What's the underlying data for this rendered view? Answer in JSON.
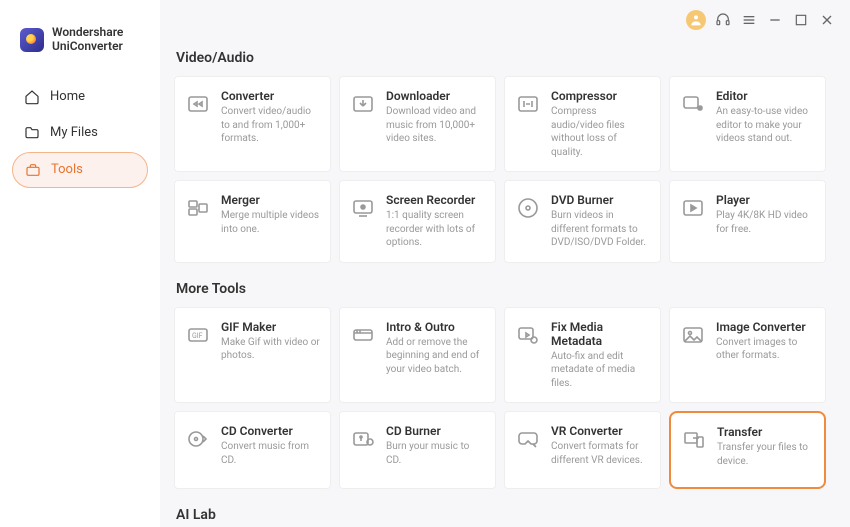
{
  "app": {
    "name": "Wondershare\nUniConverter"
  },
  "nav": {
    "home": "Home",
    "myfiles": "My Files",
    "tools": "Tools"
  },
  "sections": {
    "video_audio": "Video/Audio",
    "more_tools": "More Tools",
    "ai_lab": "AI Lab"
  },
  "cards": {
    "converter": {
      "title": "Converter",
      "desc": "Convert video/audio to and from 1,000+ formats."
    },
    "downloader": {
      "title": "Downloader",
      "desc": "Download video and music from 10,000+ video sites."
    },
    "compressor": {
      "title": "Compressor",
      "desc": "Compress audio/video files without loss of quality."
    },
    "editor": {
      "title": "Editor",
      "desc": "An easy-to-use video editor to make your videos stand out."
    },
    "merger": {
      "title": "Merger",
      "desc": "Merge multiple videos into one."
    },
    "screenrec": {
      "title": "Screen Recorder",
      "desc": "1:1 quality screen recorder with lots of options."
    },
    "dvdburner": {
      "title": "DVD Burner",
      "desc": "Burn videos in different formats to DVD/ISO/DVD Folder."
    },
    "player": {
      "title": "Player",
      "desc": "Play 4K/8K HD video for free."
    },
    "gifmaker": {
      "title": "GIF Maker",
      "desc": "Make Gif with video or photos."
    },
    "introoutro": {
      "title": "Intro & Outro",
      "desc": "Add or remove the beginning and end of your video batch."
    },
    "fixmeta": {
      "title": "Fix Media Metadata",
      "desc": "Auto-fix and edit metadate of media files."
    },
    "imgconv": {
      "title": "Image Converter",
      "desc": "Convert images to other formats."
    },
    "cdconv": {
      "title": "CD Converter",
      "desc": "Convert music from CD."
    },
    "cdburner": {
      "title": "CD Burner",
      "desc": "Burn your music to CD."
    },
    "vrconv": {
      "title": "VR Converter",
      "desc": "Convert formats for different VR devices."
    },
    "transfer": {
      "title": "Transfer",
      "desc": "Transfer your files to device."
    }
  }
}
